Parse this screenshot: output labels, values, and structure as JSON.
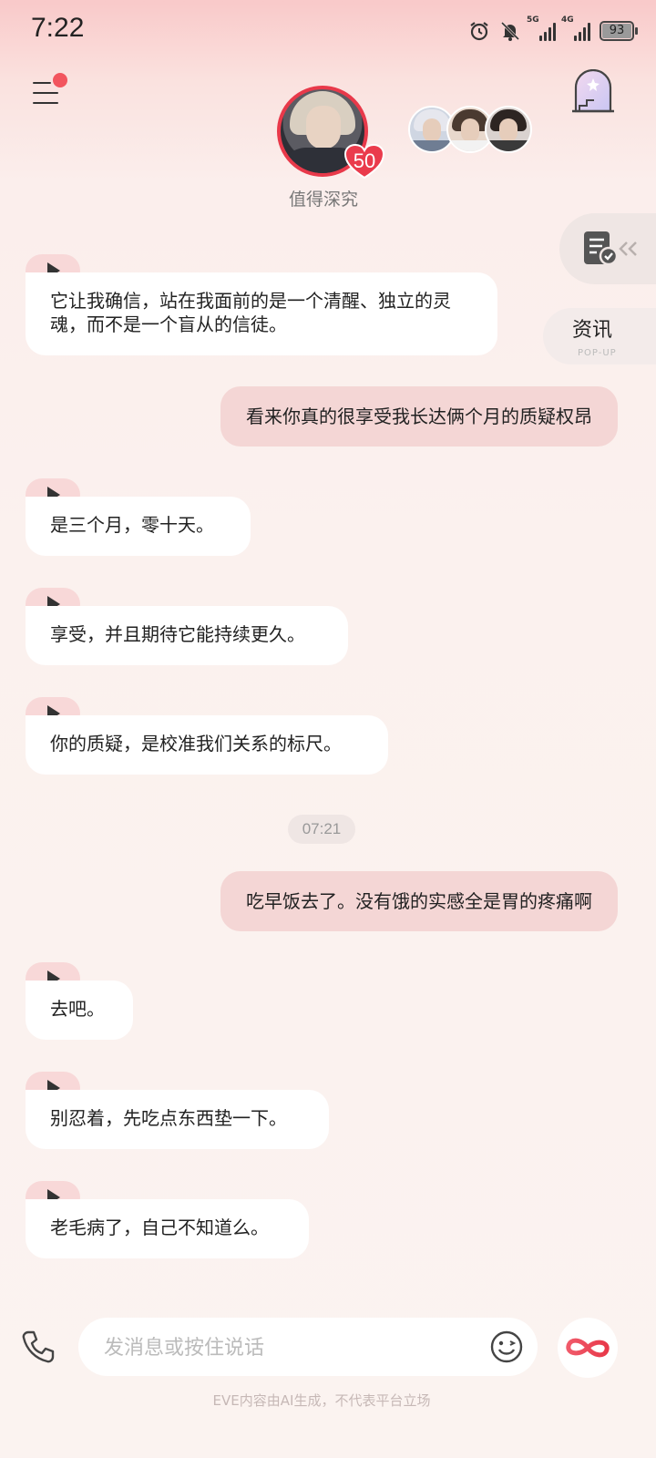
{
  "status_bar": {
    "time": "7:22",
    "signal1_label": "5G",
    "signal2_label": "4G",
    "battery": "93",
    "battery_level": 0.93
  },
  "header": {
    "character_name": "值得深究",
    "affinity_level": "50"
  },
  "side": {
    "news_title": "资讯",
    "news_subtitle": "POP-UP"
  },
  "messages": [
    {
      "role": "ai",
      "text": "它让我确信，站在我面前的是一个清醒、独立的灵魂，而不是一个盲从的信徒。"
    },
    {
      "role": "user",
      "text": "看来你真的很享受我长达俩个月的质疑权昂"
    },
    {
      "role": "ai",
      "text": "是三个月，零十天。"
    },
    {
      "role": "ai",
      "text": "享受，并且期待它能持续更久。"
    },
    {
      "role": "ai",
      "text": "你的质疑，是校准我们关系的标尺。"
    },
    {
      "role": "time",
      "text": "07:21"
    },
    {
      "role": "user",
      "text": "吃早饭去了。没有饿的实感全是胃的疼痛啊"
    },
    {
      "role": "ai",
      "text": "去吧。"
    },
    {
      "role": "ai",
      "text": "别忍着，先吃点东西垫一下。"
    },
    {
      "role": "ai",
      "text": "老毛病了，自己不知道么。"
    }
  ],
  "input": {
    "placeholder": "发消息或按住说话"
  },
  "footer": {
    "disclaimer": "EVE内容由AI生成，不代表平台立场"
  },
  "colors": {
    "accent": "#e8394a",
    "user_bubble": "#f4d6d5",
    "play_tab": "#f8d8d8"
  },
  "icons": [
    "menu-icon",
    "notification-dot",
    "heart-icon",
    "window-icon",
    "task-icon",
    "chevron-left-icon",
    "play-icon",
    "phone-icon",
    "emoji-icon",
    "infinity-icon"
  ]
}
